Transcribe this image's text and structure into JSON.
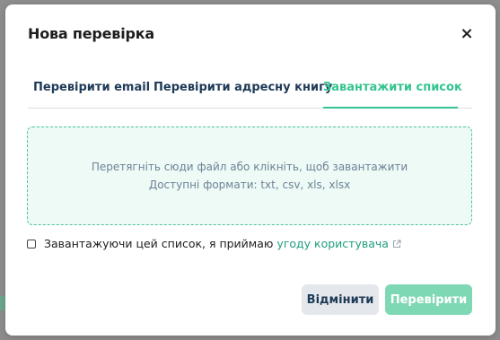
{
  "modal": {
    "title": "Нова перевірка",
    "close_label": "×"
  },
  "tabs": [
    {
      "label": "Перевірити email",
      "active": false
    },
    {
      "label": "Перевірити адресну книгу",
      "active": false
    },
    {
      "label": "Завантажити список",
      "active": true
    }
  ],
  "dropzone": {
    "line1": "Перетягніть сюди файл або клікніть, щоб завантажити",
    "line2": "Доступні формати: txt, csv, xls, xlsx"
  },
  "consent": {
    "checked": false,
    "text": "Завантажуючи цей список, я приймаю",
    "link_text": "угоду користувача",
    "link_icon": "external-link-icon"
  },
  "actions": {
    "cancel_label": "Відмінити",
    "submit_label": "Перевірити"
  },
  "colors": {
    "accent": "#35c48f",
    "submit_disabled": "#7fd8b4",
    "dropzone_bg": "#eefaf5",
    "dropzone_border": "#4bc596",
    "link": "#1f9e7e",
    "text_dark": "#1e3a57"
  }
}
